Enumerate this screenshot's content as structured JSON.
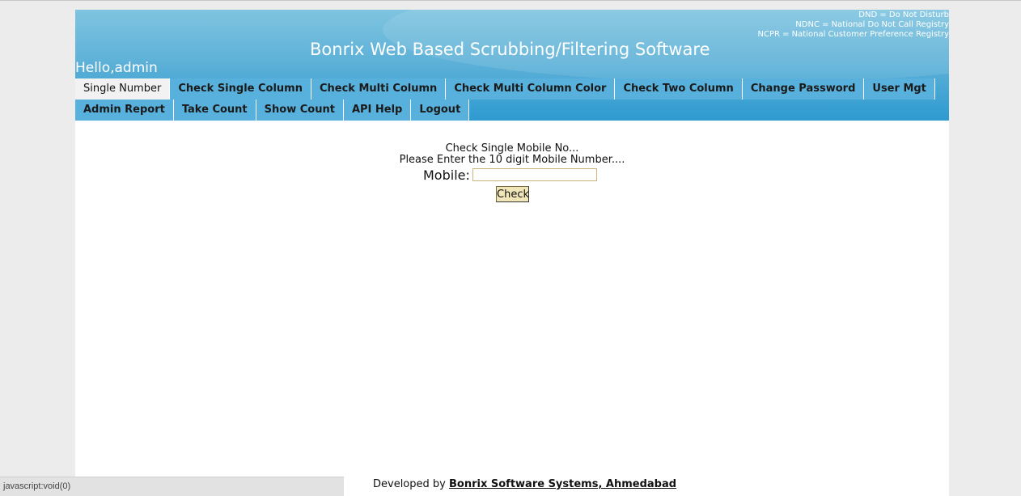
{
  "header": {
    "legend": [
      "DND = Do Not Disturb",
      "NDNC = National Do Not Call Registry",
      "NCPR = National Customer Preference Registry"
    ],
    "title": "Bonrix Web Based Scrubbing/Filtering Software",
    "greeting": "Hello,admin"
  },
  "nav": {
    "row1": [
      {
        "label": "Single Number",
        "active": true
      },
      {
        "label": "Check Single Column"
      },
      {
        "label": "Check Multi Column"
      },
      {
        "label": "Check Multi Column Color"
      },
      {
        "label": "Check Two Column"
      },
      {
        "label": "Change Password"
      },
      {
        "label": "User Mgt"
      }
    ],
    "row2": [
      {
        "label": "Admin Report"
      },
      {
        "label": "Take Count"
      },
      {
        "label": "Show Count"
      },
      {
        "label": "API Help"
      },
      {
        "label": "Logout"
      }
    ]
  },
  "form": {
    "heading": "Check Single Mobile No...",
    "instruction": "Please Enter the 10 digit Mobile Number....",
    "mobile_label": "Mobile:",
    "mobile_value": "",
    "check_label": "Check"
  },
  "footer": {
    "prefix": "Developed by",
    "link_text": "Bonrix Software Systems, Ahmedabad"
  },
  "statusbar": {
    "text": "javascript:void(0)"
  },
  "colors": {
    "header_top": "#7fc4e0",
    "header_bottom": "#2e9ad0",
    "tab_bg": "#58b0dc",
    "tab_active_bg": "#f2f2f2",
    "button_bg": "#f0e6b8"
  }
}
